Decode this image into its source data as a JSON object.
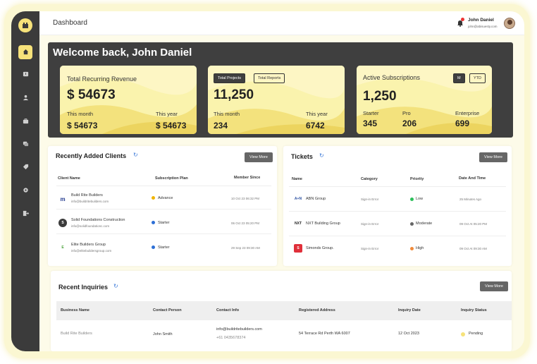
{
  "header": {
    "title": "Dashboard",
    "user_name": "John Daniel",
    "user_email": "john@abisuesty.com"
  },
  "sidebar": {
    "items": [
      {
        "icon": "home-icon",
        "active": true
      },
      {
        "icon": "report-icon",
        "active": false
      },
      {
        "icon": "user-icon",
        "active": false
      },
      {
        "icon": "briefcase-icon",
        "active": false
      },
      {
        "icon": "chat-icon",
        "active": false
      },
      {
        "icon": "tag-icon",
        "active": false
      },
      {
        "icon": "gear-icon",
        "active": false
      },
      {
        "icon": "logout-icon",
        "active": false
      }
    ]
  },
  "welcome": {
    "greeting": "Welcome back, John Daniel"
  },
  "revenue": {
    "label": "Total Recurring Revenue",
    "value": "$ 54673",
    "this_month_label": "This month",
    "this_month": "$ 54673",
    "this_year_label": "This year",
    "this_year": "$ 54673"
  },
  "projects": {
    "tab_active": "Total Projects",
    "tab_other": "Total Reports",
    "value": "11,250",
    "this_month_label": "This month",
    "this_month": "234",
    "this_year_label": "This year",
    "this_year": "6742"
  },
  "subscriptions": {
    "label": "Active Subscriptions",
    "toggle_m": "M",
    "toggle_ytd": "YTD",
    "value": "1,250",
    "starter_label": "Starter",
    "starter": "345",
    "pro_label": "Pro",
    "pro": "206",
    "enterprise_label": "Enterprise",
    "enterprise": "699"
  },
  "clients": {
    "title": "Recently Added Clients",
    "view_more": "View More",
    "columns": [
      "Client Name",
      "Subscription Plan",
      "Member Since"
    ],
    "rows": [
      {
        "logo": "m",
        "name": "Build Rite Builders",
        "email": "info@buildritebuilders.com",
        "plan": "Advance",
        "plan_color": "#f0b400",
        "since": "10 Oct 23 06:32 PM"
      },
      {
        "logo": "S",
        "name": "Solid Foundations Construction",
        "email": "info@solidfoundationc.com",
        "plan": "Starter",
        "plan_color": "#2d6fd6",
        "since": "06 Oct 23 05:20 PM"
      },
      {
        "logo": "E",
        "name": "Elite Builders Group",
        "email": "info@elitebuildersgroup.com",
        "plan": "Starter",
        "plan_color": "#2d6fd6",
        "since": "29 Sep 23 09:30 AM"
      }
    ]
  },
  "tickets": {
    "title": "Tickets",
    "view_more": "View More",
    "columns": [
      "Name",
      "Category",
      "Priority",
      "Date And Time"
    ],
    "rows": [
      {
        "logo": "A+N",
        "name": "ABN Group",
        "category": "Sign-in Error",
        "priority": "Low",
        "priority_color": "#2cbf5a",
        "date": "25 Minutes Ago"
      },
      {
        "logo": "NXT",
        "name": "NXT Building Group",
        "category": "Sign-in Error",
        "priority": "Moderate",
        "priority_color": "#666666",
        "date": "09 Oct At 05:20 PM"
      },
      {
        "logo": "S",
        "name": "Simonds Group.",
        "category": "Sign-in Error",
        "priority": "High",
        "priority_color": "#f08a3a",
        "date": "09 Oct At 09:30 AM"
      }
    ]
  },
  "inquiries": {
    "title": "Recent Inquiries",
    "view_more": "View More",
    "columns": [
      "Business Name",
      "Contact Person",
      "Contact Info",
      "Registered Address",
      "Inquiry Date",
      "Inquiry Status"
    ],
    "rows": [
      {
        "business": "Build Rite Builders",
        "person": "John Smith",
        "email": "info@buildritebuilders.com",
        "phone": "+61 0435678374",
        "address": "54 Terrace Rd Perth WA 6007",
        "date": "12 Oct 2023",
        "status": "Pending",
        "status_color": "#f6e27a"
      }
    ]
  }
}
